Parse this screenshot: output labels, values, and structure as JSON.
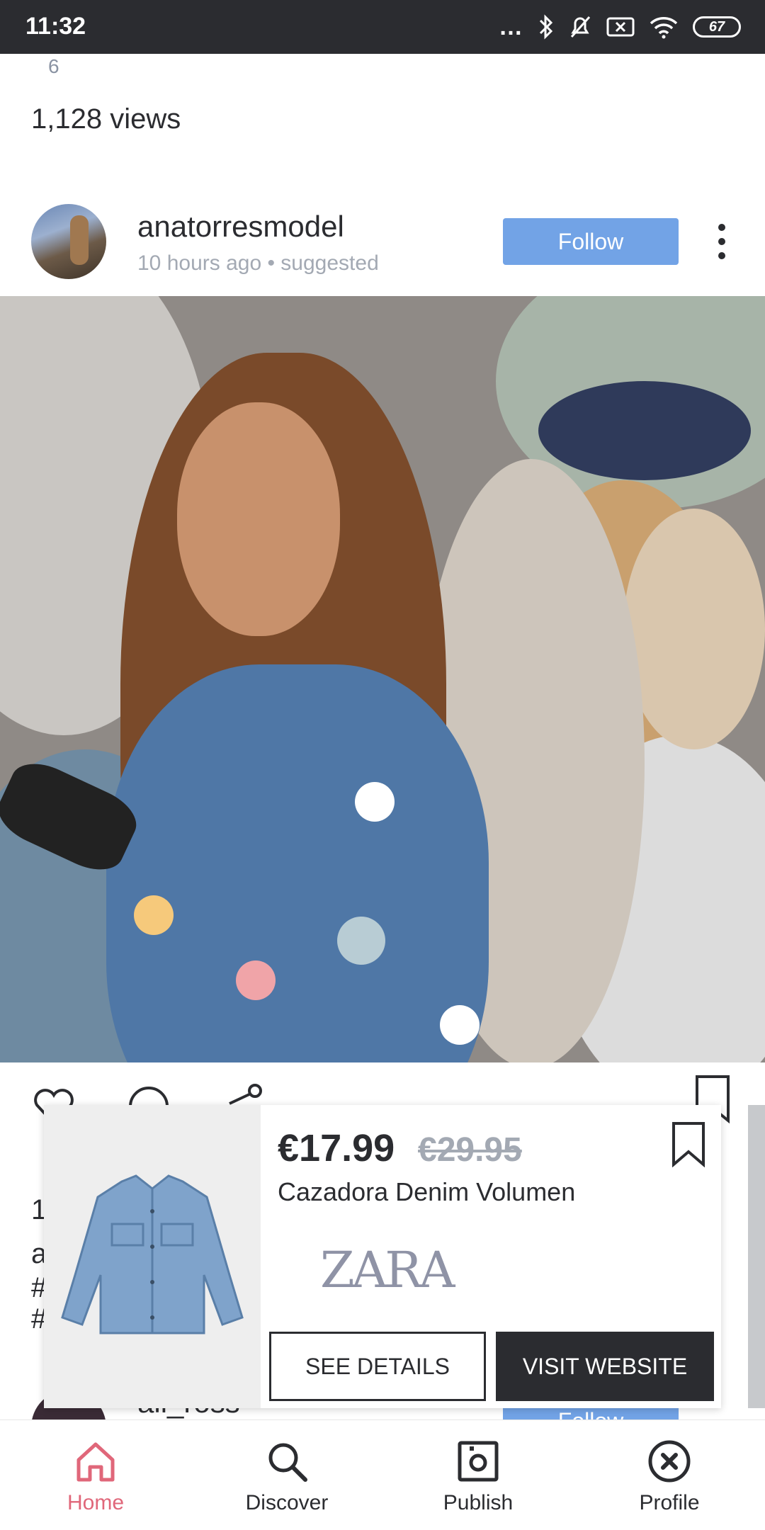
{
  "status_bar": {
    "time": "11:32",
    "battery": "67"
  },
  "previous_post": {
    "count_fragment": "6",
    "views": "1,128 views"
  },
  "post": {
    "username": "anatorresmodel",
    "meta": "10 hours ago • suggested",
    "follow_label": "Follow",
    "tag_colors": [
      "#ffffff",
      "#f6c97b",
      "#b8ccd4",
      "#f0a4a8",
      "#ffffff"
    ]
  },
  "partial_caption": [
    "1",
    "a",
    "#",
    "#"
  ],
  "product_card": {
    "price": "€17.99",
    "old_price": "€29.95",
    "name": "Cazadora Denim Volumen",
    "brand": "ZARA",
    "details_label": "SEE DETAILS",
    "visit_label": "VISIT WEBSITE"
  },
  "next_post": {
    "username": "ali_ross",
    "follow_label": "Follow"
  },
  "bottom_nav": {
    "items": [
      {
        "label": "Home",
        "icon": "home-icon",
        "active": true
      },
      {
        "label": "Discover",
        "icon": "search-icon",
        "active": false
      },
      {
        "label": "Publish",
        "icon": "camera-icon",
        "active": false
      },
      {
        "label": "Profile",
        "icon": "close-circle-icon",
        "active": false
      }
    ]
  },
  "colors": {
    "accent": "#e0677a",
    "follow": "#72a3e6",
    "dark": "#2b2c30"
  }
}
